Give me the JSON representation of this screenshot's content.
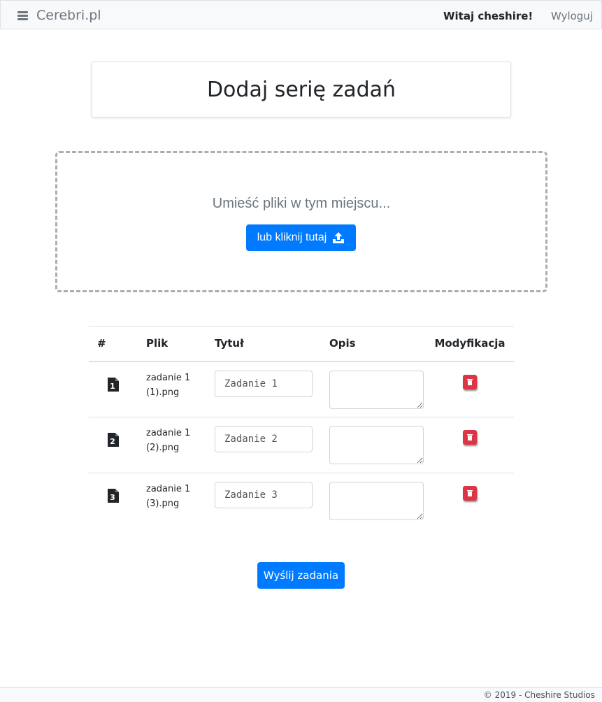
{
  "navbar": {
    "brand": "Cerebri.pl",
    "greeting": "Witaj cheshire!",
    "logout": "Wyloguj"
  },
  "page_title": "Dodaj serię zadań",
  "dropzone": {
    "text": "Umieść pliki w tym miejscu...",
    "button_label": "lub kliknij tutaj"
  },
  "table": {
    "headers": {
      "num": "#",
      "file": "Plik",
      "title": "Tytuł",
      "desc": "Opis",
      "mod": "Modyfikacja"
    },
    "rows": [
      {
        "num": "1",
        "file": "zadanie 1 (1).png",
        "title_value": "Zadanie 1",
        "desc_value": ""
      },
      {
        "num": "2",
        "file": "zadanie 1 (2).png",
        "title_value": "Zadanie 2",
        "desc_value": ""
      },
      {
        "num": "3",
        "file": "zadanie 1 (3).png",
        "title_value": "Zadanie 3",
        "desc_value": ""
      }
    ]
  },
  "submit_label": "Wyślij zadania",
  "footer": "© 2019 - Cheshire Studios",
  "colors": {
    "primary": "#007bff",
    "danger": "#dc3545",
    "muted": "#6c757d"
  },
  "icons": {
    "menu": "hamburger-icon",
    "upload": "upload-icon",
    "file": "file-icon",
    "delete": "trash-icon"
  }
}
